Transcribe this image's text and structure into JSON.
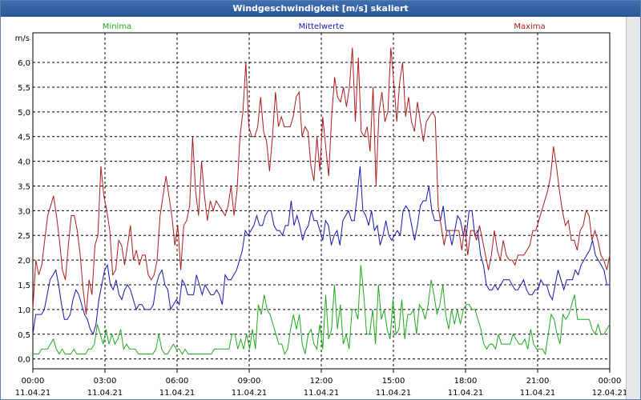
{
  "window": {
    "title": "Windgeschwindigkeit [m/s] skaliert"
  },
  "chart_data": {
    "type": "line",
    "title": "Windgeschwindigkeit [m/s] skaliert",
    "ylabel": "m/s",
    "ylim": [
      -0.2,
      6.6
    ],
    "grid": true,
    "legend_position": "top",
    "y_ticks": [
      "0,0",
      "0,5",
      "1,0",
      "1,5",
      "2,0",
      "2,5",
      "3,0",
      "3,5",
      "4,0",
      "4,5",
      "5,0",
      "5,5",
      "6,0"
    ],
    "x_ticks": [
      {
        "time": "00:00",
        "date": "11.04.21"
      },
      {
        "time": "03:00",
        "date": "11.04.21"
      },
      {
        "time": "06:00",
        "date": "11.04.21"
      },
      {
        "time": "09:00",
        "date": "11.04.21"
      },
      {
        "time": "12:00",
        "date": "11.04.21"
      },
      {
        "time": "15:00",
        "date": "11.04.21"
      },
      {
        "time": "18:00",
        "date": "11.04.21"
      },
      {
        "time": "21:00",
        "date": "11.04.21"
      },
      {
        "time": "00:00",
        "date": "12.04.21"
      }
    ],
    "x_hours": [
      0,
      24
    ],
    "series": [
      {
        "name": "Minima",
        "color": "#1fa81f",
        "values": [
          0.1,
          0.1,
          0.1,
          0.2,
          0.2,
          0.2,
          0.3,
          0.4,
          0.2,
          0.1,
          0.2,
          0.1,
          0.1,
          0.1,
          0.2,
          0.1,
          0.1,
          0.1,
          0.1,
          0.2,
          0.2,
          0.3,
          0.7,
          0.5,
          0.3,
          0.6,
          0.3,
          0.5,
          0.3,
          0.4,
          0.6,
          0.2,
          0.3,
          0.2,
          0.2,
          0.2,
          0.1,
          0.1,
          0.1,
          0.1,
          0.1,
          0.1,
          0.2,
          0.5,
          0.2,
          0.1,
          0.1,
          0.2,
          0.3,
          0.2,
          0.2,
          0.1,
          0.2,
          0.1,
          0.1,
          0.1,
          0.1,
          0.1,
          0.1,
          0.1,
          0.1,
          0.1,
          0.2,
          0.2,
          0.2,
          0.2,
          0.2,
          0.2,
          0.5,
          0.5,
          0.2,
          0.4,
          0.2,
          0.5,
          0.2,
          0.6,
          0.2,
          1.1,
          0.9,
          1.3,
          1.0,
          0.9,
          0.7,
          0.5,
          0.3,
          0.3,
          0.1,
          0.2,
          0.6,
          0.9,
          0.6,
          0.9,
          0.3,
          0.1,
          0.5,
          0.6,
          0.3,
          0.2,
          0.7,
          0.2,
          1.3,
          0.4,
          0.6,
          1.5,
          0.6,
          1.1,
          0.3,
          0.5,
          0.2,
          1.0,
          1.0,
          0.8,
          1.9,
          1.3,
          0.5,
          0.5,
          1.0,
          0.3,
          1.5,
          0.8,
          1.0,
          0.6,
          0.4,
          1.2,
          0.5,
          0.6,
          1.2,
          0.4,
          0.9,
          0.9,
          1.0,
          0.5,
          1.1,
          1.0,
          0.8,
          1.1,
          1.6,
          1.3,
          0.9,
          1.1,
          1.5,
          0.9,
          0.6,
          1.0,
          0.7,
          1.0,
          0.7,
          1.0,
          1.1,
          1.1,
          1.0,
          1.0,
          0.8,
          0.6,
          0.3,
          0.2,
          0.3,
          0.3,
          0.2,
          0.5,
          0.3,
          0.3,
          0.3,
          0.3,
          0.5,
          0.4,
          0.3,
          0.3,
          0.4,
          0.2,
          0.6,
          0.3,
          0.2,
          0.2,
          0.2,
          0.1,
          0.5,
          0.9,
          0.8,
          0.5,
          0.3,
          0.9,
          0.8,
          0.9,
          1.1,
          1.3,
          0.8,
          0.8,
          0.8,
          0.8,
          0.8,
          0.6,
          0.5,
          0.7,
          0.5,
          0.5,
          0.6,
          0.7
        ]
      },
      {
        "name": "Mittelwerte",
        "color": "#1515b0",
        "values": [
          0.5,
          0.9,
          0.9,
          0.9,
          1.0,
          1.3,
          1.6,
          1.7,
          1.8,
          1.5,
          1.1,
          0.8,
          0.8,
          0.9,
          1.2,
          1.4,
          1.3,
          1.1,
          0.9,
          0.8,
          0.6,
          0.5,
          0.7,
          1.2,
          1.5,
          1.8,
          1.9,
          1.5,
          1.4,
          1.6,
          1.3,
          1.2,
          1.4,
          1.5,
          1.4,
          1.2,
          1.0,
          1.1,
          1.1,
          1.0,
          1.0,
          1.0,
          1.1,
          1.5,
          1.7,
          1.8,
          1.5,
          1.4,
          1.0,
          1.1,
          1.2,
          1.1,
          1.6,
          1.5,
          1.3,
          1.3,
          1.3,
          1.7,
          1.5,
          1.3,
          1.5,
          1.4,
          1.3,
          1.3,
          1.4,
          1.3,
          1.1,
          1.7,
          1.6,
          1.6,
          1.7,
          1.8,
          2.0,
          2.2,
          2.6,
          2.5,
          2.6,
          2.7,
          2.9,
          2.7,
          2.7,
          2.9,
          3.0,
          3.0,
          2.7,
          2.6,
          2.6,
          2.5,
          2.7,
          2.7,
          3.2,
          2.7,
          2.9,
          2.7,
          2.4,
          2.6,
          2.7,
          3.0,
          2.8,
          2.8,
          2.6,
          2.4,
          2.8,
          2.7,
          2.3,
          2.5,
          2.6,
          2.3,
          2.8,
          2.9,
          3.0,
          2.8,
          2.8,
          3.3,
          3.9,
          3.0,
          2.9,
          2.7,
          3.0,
          2.6,
          2.7,
          2.3,
          2.5,
          2.8,
          2.5,
          2.4,
          2.5,
          2.6,
          2.5,
          3.0,
          3.1,
          3.0,
          2.7,
          2.4,
          2.7,
          3.1,
          3.2,
          3.2,
          3.5,
          3.0,
          2.8,
          2.8,
          2.8,
          3.1,
          2.6,
          2.6,
          2.3,
          2.6,
          2.9,
          2.8,
          2.5,
          2.5,
          3.0,
          3.0,
          2.5,
          2.6,
          2.1,
          1.9,
          1.5,
          1.4,
          1.4,
          1.5,
          1.4,
          1.5,
          1.6,
          1.6,
          1.6,
          1.5,
          1.4,
          1.4,
          1.5,
          1.6,
          1.4,
          1.3,
          1.3,
          1.4,
          1.4,
          1.6,
          1.5,
          1.5,
          1.3,
          1.2,
          1.5,
          1.8,
          1.6,
          1.4,
          1.6,
          1.6,
          1.6,
          1.8,
          1.7,
          1.9,
          2.0,
          2.1,
          2.2,
          2.4,
          2.1,
          2.0,
          1.9,
          1.8,
          1.5,
          1.5
        ]
      },
      {
        "name": "Maxima",
        "color": "#aa1c1c",
        "values": [
          1.0,
          2.0,
          1.7,
          1.9,
          2.4,
          2.9,
          3.1,
          3.3,
          2.9,
          2.4,
          1.8,
          1.6,
          2.3,
          2.9,
          2.9,
          2.6,
          2.1,
          1.4,
          0.9,
          1.6,
          1.3,
          2.3,
          2.5,
          3.9,
          3.3,
          3.0,
          2.6,
          1.7,
          1.8,
          2.4,
          2.3,
          1.9,
          2.3,
          2.7,
          2.0,
          2.2,
          1.9,
          2.1,
          2.1,
          1.7,
          1.6,
          1.7,
          2.0,
          2.9,
          3.3,
          3.7,
          3.3,
          2.9,
          2.3,
          2.7,
          1.8,
          2.7,
          2.8,
          3.1,
          4.5,
          3.4,
          2.9,
          4.0,
          3.3,
          2.8,
          3.2,
          3.0,
          3.2,
          3.1,
          3.0,
          2.9,
          3.1,
          3.5,
          2.9,
          3.4,
          4.5,
          5.0,
          6.0,
          4.7,
          4.5,
          4.5,
          4.7,
          5.3,
          4.6,
          4.4,
          3.8,
          4.5,
          5.4,
          4.7,
          4.9,
          4.7,
          4.7,
          4.7,
          4.9,
          5.3,
          5.4,
          4.5,
          4.7,
          4.6,
          3.9,
          3.6,
          4.5,
          3.8,
          4.9,
          4.3,
          3.7,
          4.9,
          5.7,
          5.3,
          5.2,
          5.5,
          5.1,
          5.5,
          6.3,
          4.8,
          6.1,
          4.6,
          4.5,
          4.7,
          4.2,
          5.5,
          3.5,
          5.0,
          5.4,
          4.8,
          5.0,
          6.3,
          5.6,
          4.8,
          5.6,
          6.0,
          4.9,
          5.3,
          4.8,
          4.6,
          5.2,
          4.8,
          4.4,
          4.8,
          4.9,
          5.0,
          4.9,
          3.1,
          2.7,
          2.3,
          2.6,
          2.6,
          2.6,
          2.6,
          2.6,
          2.2,
          2.7,
          2.1,
          2.6,
          2.6,
          2.4,
          2.7,
          2.4,
          2.1,
          1.8,
          2.1,
          2.6,
          2.2,
          2.0,
          2.4,
          2.1,
          2.0,
          2.0,
          1.9,
          2.1,
          2.1,
          2.1,
          2.2,
          2.3,
          2.6,
          2.6,
          2.8,
          3.0,
          3.2,
          3.4,
          3.7,
          4.3,
          3.9,
          3.4,
          3.0,
          2.7,
          2.8,
          2.4,
          2.4,
          2.2,
          2.6,
          2.7,
          3.0,
          2.9,
          2.4,
          2.6,
          2.4,
          2.1,
          2.0,
          1.8,
          2.1
        ]
      }
    ]
  }
}
